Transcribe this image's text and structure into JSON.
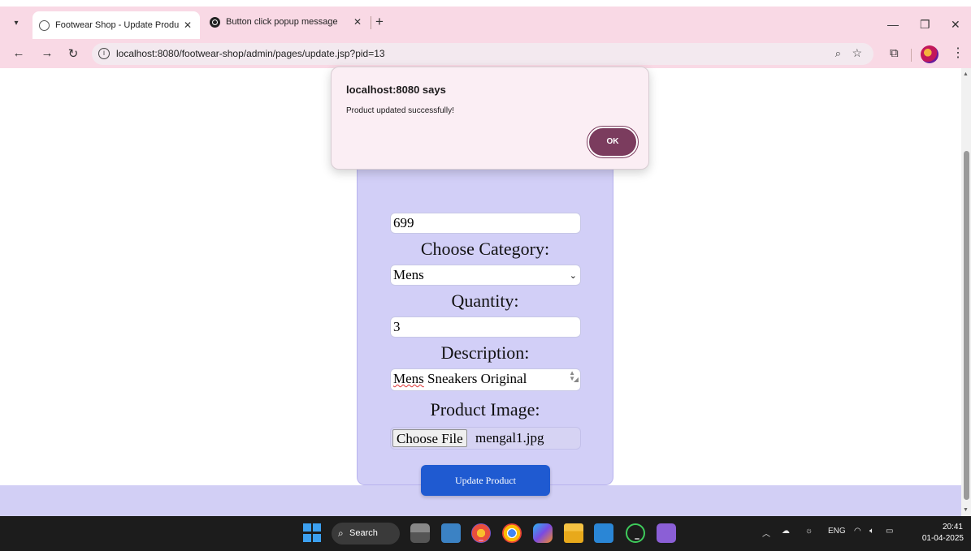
{
  "browser": {
    "tabs": [
      {
        "title": "Footwear Shop - Update Produ",
        "active": true
      },
      {
        "title": "Button click popup message",
        "active": false
      }
    ],
    "url": "localhost:8080/footwear-shop/admin/pages/update.jsp?pid=13"
  },
  "form": {
    "price_value": "699",
    "category_label": "Choose Category:",
    "category_value": "Mens",
    "quantity_label": "Quantity:",
    "quantity_value": "3",
    "description_label": "Description:",
    "description_first_word": "Mens",
    "description_rest": " Sneakers Original",
    "image_label": "Product Image:",
    "choose_file_label": "Choose File",
    "file_name": "mengal1.jpg",
    "submit_label": "Update Product"
  },
  "alert": {
    "title": "localhost:8080 says",
    "message": "Product updated successfully!",
    "ok_label": "OK"
  },
  "taskbar": {
    "search_label": "Search",
    "language": "ENG",
    "time": "20:41",
    "date": "01-04-2025",
    "apps": [
      "task-view",
      "3d-box",
      "chrome-canary",
      "chrome",
      "copilot",
      "file-explorer",
      "vscode",
      "whatsapp",
      "visual-studio"
    ]
  },
  "colors": {
    "chrome_bg": "#f9d9e5",
    "card_bg": "#d2cff7",
    "button_blue": "#1f5ad1",
    "alert_ok": "#7b3c5e"
  }
}
